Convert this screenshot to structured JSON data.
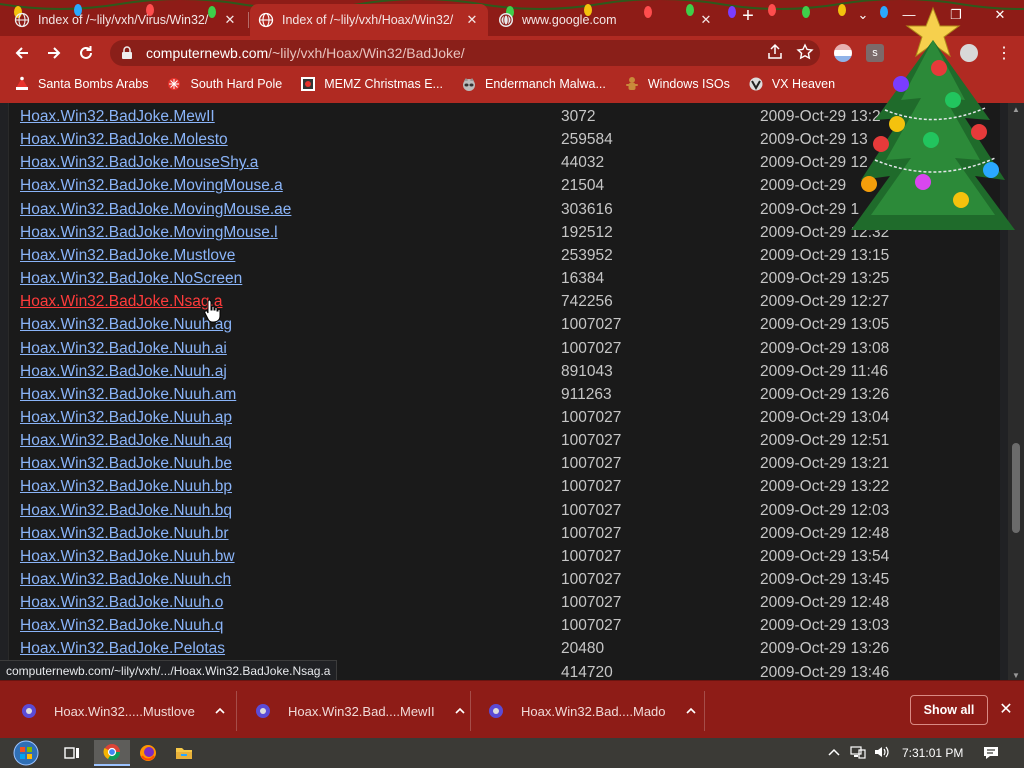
{
  "tabs": [
    {
      "title": "Index of /~lily/vxh/Virus/Win32/",
      "active": false
    },
    {
      "title": "Index of /~lily/vxh/Hoax/Win32/",
      "active": true
    },
    {
      "title": "www.google.com",
      "active": false
    }
  ],
  "toolbar": {
    "url_host": "computernewb.com",
    "url_path": "/~lily/vxh/Hoax/Win32/BadJoke/"
  },
  "bookmarks": [
    {
      "label": "Santa Bombs Arabs",
      "icon": "santa-icon"
    },
    {
      "label": "South Hard Pole",
      "icon": "snowflake-icon"
    },
    {
      "label": "MEMZ Christmas E...",
      "icon": "memz-icon"
    },
    {
      "label": "Endermanch Malwa...",
      "icon": "raccoon-icon"
    },
    {
      "label": "Windows ISOs",
      "icon": "gingerbread-icon"
    },
    {
      "label": "VX Heaven",
      "icon": "vx-icon"
    }
  ],
  "files": [
    {
      "name": "Hoax.Win32.BadJoke.MewII",
      "size": "3072",
      "date": "2009-Oct-29 13:2"
    },
    {
      "name": "Hoax.Win32.BadJoke.Molesto",
      "size": "259584",
      "date": "2009-Oct-29 13"
    },
    {
      "name": "Hoax.Win32.BadJoke.MouseShy.a",
      "size": "44032",
      "date": "2009-Oct-29 12"
    },
    {
      "name": "Hoax.Win32.BadJoke.MovingMouse.a",
      "size": "21504",
      "date": "2009-Oct-29"
    },
    {
      "name": "Hoax.Win32.BadJoke.MovingMouse.ae",
      "size": "303616",
      "date": "2009-Oct-29 1"
    },
    {
      "name": "Hoax.Win32.BadJoke.MovingMouse.l",
      "size": "192512",
      "date": "2009-Oct-29 12:32"
    },
    {
      "name": "Hoax.Win32.BadJoke.Mustlove",
      "size": "253952",
      "date": "2009-Oct-29 13:15"
    },
    {
      "name": "Hoax.Win32.BadJoke.NoScreen",
      "size": "16384",
      "date": "2009-Oct-29 13:25"
    },
    {
      "name": "Hoax.Win32.BadJoke.Nsag.a",
      "size": "742256",
      "date": "2009-Oct-29 12:27"
    },
    {
      "name": "Hoax.Win32.BadJoke.Nuuh.ag",
      "size": "1007027",
      "date": "2009-Oct-29 13:05"
    },
    {
      "name": "Hoax.Win32.BadJoke.Nuuh.ai",
      "size": "1007027",
      "date": "2009-Oct-29 13:08"
    },
    {
      "name": "Hoax.Win32.BadJoke.Nuuh.aj",
      "size": "891043",
      "date": "2009-Oct-29 11:46"
    },
    {
      "name": "Hoax.Win32.BadJoke.Nuuh.am",
      "size": "911263",
      "date": "2009-Oct-29 13:26"
    },
    {
      "name": "Hoax.Win32.BadJoke.Nuuh.ap",
      "size": "1007027",
      "date": "2009-Oct-29 13:04"
    },
    {
      "name": "Hoax.Win32.BadJoke.Nuuh.aq",
      "size": "1007027",
      "date": "2009-Oct-29 12:51"
    },
    {
      "name": "Hoax.Win32.BadJoke.Nuuh.be",
      "size": "1007027",
      "date": "2009-Oct-29 13:21"
    },
    {
      "name": "Hoax.Win32.BadJoke.Nuuh.bp",
      "size": "1007027",
      "date": "2009-Oct-29 13:22"
    },
    {
      "name": "Hoax.Win32.BadJoke.Nuuh.bq",
      "size": "1007027",
      "date": "2009-Oct-29 12:03"
    },
    {
      "name": "Hoax.Win32.BadJoke.Nuuh.br",
      "size": "1007027",
      "date": "2009-Oct-29 12:48"
    },
    {
      "name": "Hoax.Win32.BadJoke.Nuuh.bw",
      "size": "1007027",
      "date": "2009-Oct-29 13:54"
    },
    {
      "name": "Hoax.Win32.BadJoke.Nuuh.ch",
      "size": "1007027",
      "date": "2009-Oct-29 13:45"
    },
    {
      "name": "Hoax.Win32.BadJoke.Nuuh.o",
      "size": "1007027",
      "date": "2009-Oct-29 12:48"
    },
    {
      "name": "Hoax.Win32.BadJoke.Nuuh.q",
      "size": "1007027",
      "date": "2009-Oct-29 13:03"
    },
    {
      "name": "Hoax.Win32.BadJoke.Pelotas",
      "size": "20480",
      "date": "2009-Oct-29 13:26"
    },
    {
      "name": "",
      "size": "414720",
      "date": "2009-Oct-29 13:46"
    }
  ],
  "hovered_file": "Hoax.Win32.BadJoke.Nsag.a",
  "status_url": "computernewb.com/~lily/vxh/.../Hoax.Win32.BadJoke.Nsag.a",
  "downloads": [
    {
      "label": "Hoax.Win32.....Mustlove"
    },
    {
      "label": "Hoax.Win32.Bad....MewII"
    },
    {
      "label": "Hoax.Win32.Bad....Mado"
    }
  ],
  "download_shelf": {
    "show_all": "Show all"
  },
  "taskbar": {
    "clock": "7:31:01 PM"
  },
  "colors": {
    "theme": "#b02a22",
    "tabstrip": "#8e1c17",
    "link": "#8ab4f8",
    "hover_link": "#ff3b3b"
  }
}
